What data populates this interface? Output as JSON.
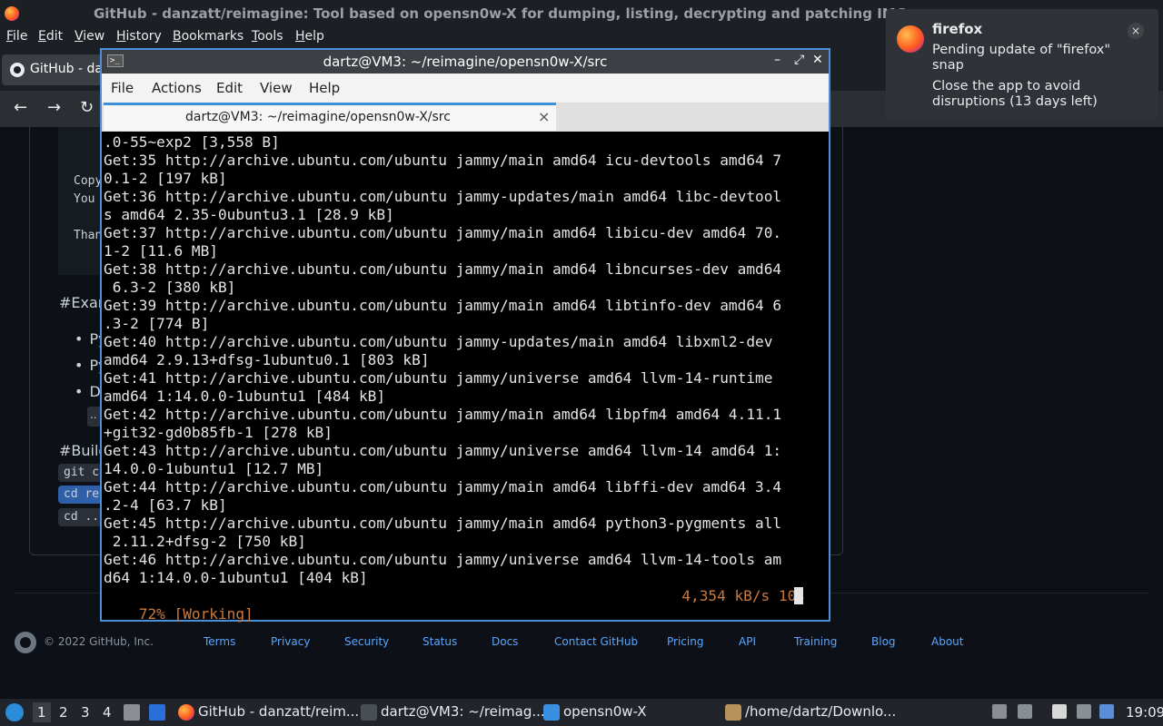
{
  "browser": {
    "window_title": "GitHub - danzatt/reimagine: Tool based on opensn0w-X for dumping, listing, decrypting and patching IMG",
    "menu": [
      "File",
      "Edit",
      "View",
      "History",
      "Bookmarks",
      "Tools",
      "Help"
    ],
    "tab_label": "GitHub - danzatt/",
    "nav": {
      "back": "←",
      "forward": "→",
      "reload": "↻"
    }
  },
  "page": {
    "code_lines": [
      "Copy",
      "You",
      "Than"
    ],
    "headings": [
      "#Exam",
      "#Build"
    ],
    "bullets": [
      "Py",
      "Py",
      "De"
    ],
    "bullet_chip": "..",
    "chips": [
      "git c",
      "cd re",
      "cd .."
    ],
    "footer": {
      "copyright": "© 2022 GitHub, Inc.",
      "links": [
        "Terms",
        "Privacy",
        "Security",
        "Status",
        "Docs",
        "Contact GitHub",
        "Pricing",
        "API",
        "Training",
        "Blog",
        "About"
      ]
    }
  },
  "terminal": {
    "icon": ">_",
    "title": "dartz@VM3: ~/reimagine/opensn0w-X/src",
    "menu": [
      "File",
      "Actions",
      "Edit",
      "View",
      "Help"
    ],
    "tab_title": "dartz@VM3: ~/reimagine/opensn0w-X/src",
    "output": ".0-55~exp2 [3,558 B]\nGet:35 http://archive.ubuntu.com/ubuntu jammy/main amd64 icu-devtools amd64 7\n0.1-2 [197 kB]\nGet:36 http://archive.ubuntu.com/ubuntu jammy-updates/main amd64 libc-devtool\ns amd64 2.35-0ubuntu3.1 [28.9 kB]\nGet:37 http://archive.ubuntu.com/ubuntu jammy/main amd64 libicu-dev amd64 70.\n1-2 [11.6 MB]\nGet:38 http://archive.ubuntu.com/ubuntu jammy/main amd64 libncurses-dev amd64\n 6.3-2 [380 kB]\nGet:39 http://archive.ubuntu.com/ubuntu jammy/main amd64 libtinfo-dev amd64 6\n.3-2 [774 B]\nGet:40 http://archive.ubuntu.com/ubuntu jammy-updates/main amd64 libxml2-dev\namd64 2.9.13+dfsg-1ubuntu0.1 [803 kB]\nGet:41 http://archive.ubuntu.com/ubuntu jammy/universe amd64 llvm-14-runtime\namd64 1:14.0.0-1ubuntu1 [484 kB]\nGet:42 http://archive.ubuntu.com/ubuntu jammy/main amd64 libpfm4 amd64 4.11.1\n+git32-gd0b85fb-1 [278 kB]\nGet:43 http://archive.ubuntu.com/ubuntu jammy/universe amd64 llvm-14 amd64 1:\n14.0.0-1ubuntu1 [12.7 MB]\nGet:44 http://archive.ubuntu.com/ubuntu jammy/main amd64 libffi-dev amd64 3.4\n.2-4 [63.7 kB]\nGet:45 http://archive.ubuntu.com/ubuntu jammy/main amd64 python3-pygments all\n 2.11.2+dfsg-2 [750 kB]\nGet:46 http://archive.ubuntu.com/ubuntu jammy/universe amd64 llvm-14-tools am\nd64 1:14.0.0-1ubuntu1 [404 kB]",
    "status_left": "72% [Working]",
    "status_right": "4,354 kB/s 10s"
  },
  "notification": {
    "app": "firefox",
    "line1": "Pending update of \"firefox\" snap",
    "line2": "Close the app to avoid disruptions (13 days left)",
    "close": "×"
  },
  "taskbar": {
    "workspaces": [
      "1",
      "2",
      "3",
      "4"
    ],
    "tasks": [
      "GitHub - danzatt/reim...",
      "dartz@VM3: ~/reimag...",
      "opensn0w-X",
      "/home/dartz/Downlo..."
    ],
    "clock": "19:09"
  }
}
